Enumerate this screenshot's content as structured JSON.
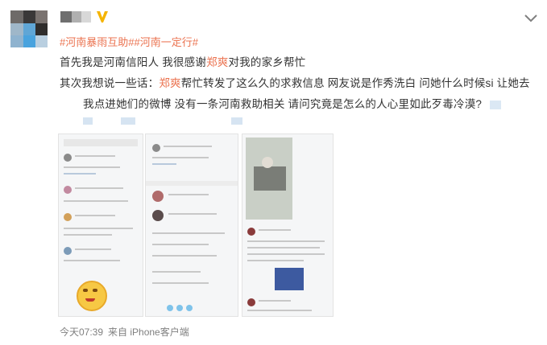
{
  "post": {
    "topics": "#河南暴雨互助##河南一定行#",
    "line1": {
      "pre": "首先我是河南信阳人 我很感谢",
      "name": "郑爽",
      "post": "对我的家乡帮忙"
    },
    "line2": {
      "pre": "其次我想说一些话：",
      "name": "郑爽",
      "post": "帮忙转发了这么久的求救信息 网友说是作秀洗白 问她什么时候si 让她去"
    },
    "line3": "我点进她们的微博 没有一条河南救助相关 请问究竟是怎么的人心里如此歹毒冷漠?",
    "footer": {
      "time": "今天07:39",
      "source": "来自 iPhone客户端"
    }
  },
  "colors": {
    "accent": "#eb7350",
    "vip": "#f5b400",
    "text": "#333333",
    "meta": "#808080"
  },
  "icons": {
    "vip": "vip-badge-icon",
    "more": "chevron-down-icon"
  }
}
